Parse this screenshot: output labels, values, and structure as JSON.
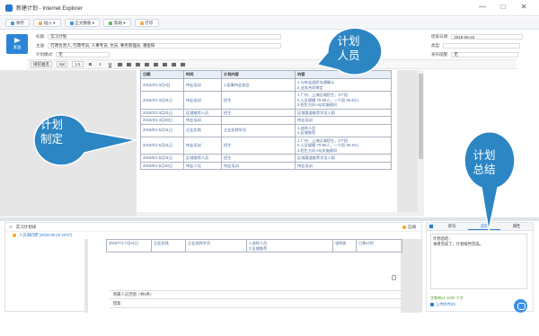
{
  "window": {
    "title": "新建计划 - Internet Explorer",
    "controls": [
      "—",
      "□",
      "✕"
    ]
  },
  "toolbar": {
    "buttons": [
      {
        "label": "保存",
        "icon": "save-icon"
      },
      {
        "label": "插入 ▾",
        "icon": "insert-icon"
      },
      {
        "label": "正文模板 ▾",
        "icon": "template-icon"
      },
      {
        "label": "帮助 ▾",
        "icon": "help-icon"
      },
      {
        "label": "打印",
        "icon": "print-icon"
      }
    ]
  },
  "send": {
    "label": "发送"
  },
  "form": {
    "title_label": "标题:",
    "title_value": "实习计划",
    "recipients_label": "主送:",
    "recipients_value": "行政负责人, 行政专员, 人事专员, 文员, 事务管理员, 潘伯阳",
    "mode_label": "计划模式:",
    "mode_value": "无",
    "date_label": "结束日期:",
    "date_value": "2018-06-22",
    "type_label": "类型:",
    "type_value": "",
    "remind_label": "发布提醒:",
    "remind_value": "无"
  },
  "format_bar": {
    "font": "微软雅黑",
    "size": "9pt",
    "line": "1.5",
    "bold": "B",
    "italic": "I",
    "underline": "U"
  },
  "table": {
    "headers": [
      "日期",
      "时间",
      "计划内容",
      "内容"
    ],
    "rows": [
      [
        "2018/3/1-3月3日",
        "待业培训",
        "1.医事待业协会",
        "1.与待业组织沟通确认\n2.业务合同审定"
      ],
      [
        "2018/3/1-3月31日",
        "待业培训",
        "招生",
        "1.广州、上海区域招生，2个班\n2.人员规模 70-80人，一个班 35-40人\n3.招生方向  erp实施顾问"
      ],
      [
        "2018/3/1-3月31日",
        "区域推荐人员",
        "招生",
        "区域渠道推荐学员入职"
      ],
      [
        "2018/4/1-4月30日",
        "待业培训",
        "",
        "待业培训"
      ],
      [
        "2018/5/1-5月31日",
        "企业实践",
        "企业实践学员",
        "1.选择人员\n2.区域推荐"
      ],
      [
        "2018/5/1-5月31日",
        "待业培训",
        "招生",
        "1.广州、上海区域招生，2个班\n2.人员规模 70-80人，一个班 35-40人\n3.招生方向  erp实施顾问"
      ],
      [
        "2018/5/1-5月31日",
        "区域推荐人员",
        "招生",
        "区域渠道推荐学员入职"
      ],
      [
        "2018/6/1-6月30日",
        "待业二培",
        "待业培训",
        "待业培训"
      ]
    ]
  },
  "bottom": {
    "header_label": "实习计划详",
    "sender": "人员调招聘 (2018-06-22 10:57)",
    "status": "已阅",
    "row": {
      "date": "2018/7/1-7月31日",
      "type": "企业实践",
      "content": "企业选择学员",
      "detail": "1.选择人员\n2.区域推荐",
      "person": "张四凯",
      "remark": "已按计划"
    },
    "foot1": "附属人员范围（共0条）",
    "foot2": "回复"
  },
  "summary": {
    "tabs": [
      "状况",
      "总结",
      "属性"
    ],
    "active_tab": "总结",
    "box_label": "计划总结：",
    "box_text": "本周完成了。计划按时完成。",
    "count": "字数统计 1000 个字",
    "link": "上传附件(0)"
  },
  "callouts": [
    {
      "text": "计划\n人员"
    },
    {
      "text": "计划\n制定"
    },
    {
      "text": "计划\n总结"
    }
  ]
}
